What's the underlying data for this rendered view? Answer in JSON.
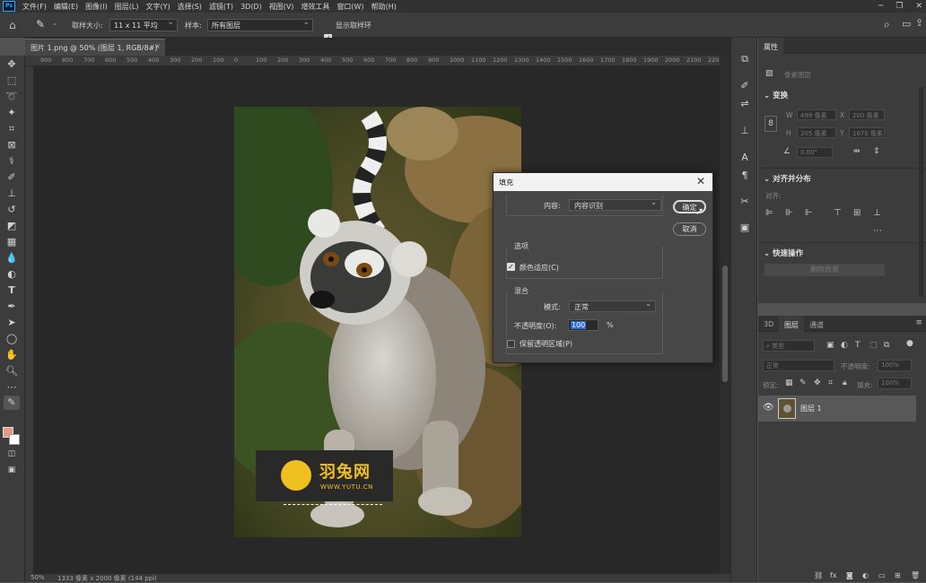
{
  "menubar": {
    "items": [
      "文件(F)",
      "编辑(E)",
      "图像(I)",
      "图层(L)",
      "文字(Y)",
      "选择(S)",
      "滤镜(T)",
      "3D(D)",
      "视图(V)",
      "增效工具",
      "窗口(W)",
      "帮助(H)"
    ]
  },
  "options": {
    "sample_size_label": "取样大小:",
    "sample_size_value": "11 x 11 平均",
    "sample_label": "样本:",
    "sample_value": "所有图层",
    "show_ring_label": "显示取样环"
  },
  "document": {
    "tab_title": "图片 1.png @ 50% (图层 1, RGB/8#)",
    "zoom": "50%",
    "size_info": "1333 像素 x 2000 像素 (144 ppi)"
  },
  "ruler": {
    "ticks": [
      "900",
      "800",
      "700",
      "600",
      "500",
      "400",
      "300",
      "200",
      "100",
      "0",
      "100",
      "200",
      "300",
      "400",
      "500",
      "600",
      "700",
      "800",
      "900",
      "1000",
      "1100",
      "1200",
      "1300",
      "1400",
      "1500",
      "1600",
      "1700",
      "1800",
      "1900",
      "2000",
      "2100",
      "220"
    ]
  },
  "watermark": {
    "name": "羽兔网",
    "url": "WWW.YUTU.CN"
  },
  "dialog": {
    "title": "填充",
    "content_label": "内容:",
    "content_value": "内容识别",
    "ok": "确定",
    "cancel": "取消",
    "options_title": "选项",
    "color_adapt": "颜色适应(C)",
    "blend_title": "混合",
    "mode_label": "模式:",
    "mode_value": "正常",
    "opacity_label": "不透明度(O):",
    "opacity_value": "100",
    "opacity_unit": "%",
    "preserve": "保留透明区域(P)"
  },
  "properties": {
    "tab": "属性",
    "pixel_layer": "像素图层",
    "transform_title": "变换",
    "w_label": "W",
    "w_value": "499 像素",
    "x_label": "X",
    "x_value": "200 像素",
    "h_label": "H",
    "h_value": "205 像素",
    "y_label": "Y",
    "y_value": "1670 像素",
    "angle_value": "0.00°",
    "align_title": "对齐并分布",
    "align_label": "对齐:",
    "quick_title": "快速操作",
    "remove_bg": "删除背景"
  },
  "layers": {
    "tabs": [
      "3D",
      "图层",
      "通道"
    ],
    "filter_placeholder": "类型",
    "blend_mode": "正常",
    "opacity_label": "不透明度:",
    "opacity_value": "100%",
    "lock_label": "锁定:",
    "fill_label": "填充:",
    "fill_value": "100%",
    "layer_name": "图层 1"
  }
}
